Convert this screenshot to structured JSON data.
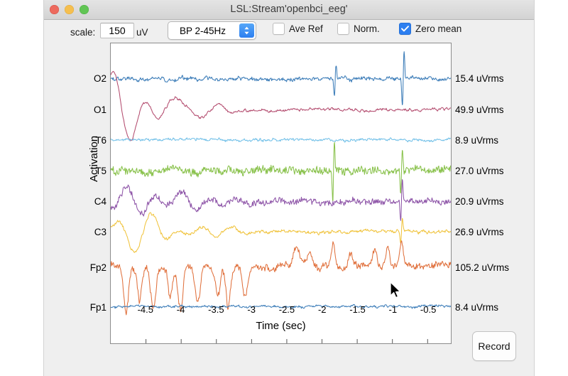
{
  "window": {
    "title": "LSL:Stream'openbci_eeg'",
    "traffic_lights": [
      "close-red",
      "minimize-yellow",
      "zoom-green"
    ]
  },
  "toolbar": {
    "scale_label": "scale:",
    "scale_value": "150",
    "scale_placeholder": "150",
    "unit_label": "uV",
    "filter_selected": "BP 2-45Hz",
    "filter_options": [
      "BP 2-45Hz"
    ],
    "checkboxes": [
      {
        "name": "ave-ref",
        "label": "Ave Ref",
        "checked": false
      },
      {
        "name": "norm",
        "label": "Norm.",
        "checked": false
      },
      {
        "name": "zero-mean",
        "label": "Zero mean",
        "checked": true
      }
    ]
  },
  "plot": {
    "ylabel": "Activation",
    "xlabel": "Time (sec)",
    "xticks": [
      "-4.5",
      "-4",
      "-3.5",
      "-3",
      "-2.5",
      "-2",
      "-1.5",
      "-1",
      "-0.5"
    ],
    "channel_labels": [
      "O2",
      "O1",
      "T6",
      "T5",
      "C4",
      "C3",
      "Fp2",
      "Fp1"
    ],
    "rms_labels": [
      "15.4 uVrms",
      "49.9 uVrms",
      "8.9 uVrms",
      "27.0 uVrms",
      "20.9 uVrms",
      "26.9 uVrms",
      "105.2 uVrms",
      "8.4 uVrms"
    ]
  },
  "buttons": {
    "record": "Record"
  },
  "colors": {
    "accent": "#2d7ff0",
    "window_bg": "#efefef",
    "plot_bg": "#ffffff",
    "traces": {
      "O2": "#3b7cb8",
      "O1": "#b34b6e",
      "T6": "#72c0e8",
      "T5": "#88c14a",
      "C4": "#8e55a8",
      "C3": "#f0c33c",
      "Fp2": "#e0703c",
      "Fp1": "#3b7cb8"
    }
  },
  "chart_data": {
    "type": "line",
    "title": "LSL:Stream'openbci_eeg'",
    "xlabel": "Time (sec)",
    "ylabel": "Activation",
    "xlim": [
      -5.0,
      -0.17
    ],
    "xticks": [
      -4.5,
      -4,
      -3.5,
      -3,
      -2.5,
      -2,
      -1.5,
      -1,
      -0.5
    ],
    "grid": false,
    "legend": "right-rms-annotations",
    "scale_uV": 150,
    "filter": "BP 2-45Hz",
    "series": [
      {
        "name": "O2",
        "color": "#3b7cb8",
        "rms_uV": 15.4,
        "baseline_y_frac": 0.118,
        "amplitude": 0.03,
        "noise": 0.9,
        "spikes": [
          [
            0.66,
            1.7
          ],
          [
            0.86,
            3.2
          ]
        ]
      },
      {
        "name": "O1",
        "color": "#b34b6e",
        "rms_uV": 49.9,
        "baseline_y_frac": 0.222,
        "amplitude": 0.03,
        "noise": 0.5,
        "slow_wave": true,
        "spikes": []
      },
      {
        "name": "T6",
        "color": "#72c0e8",
        "rms_uV": 8.9,
        "baseline_y_frac": 0.322,
        "amplitude": 0.022,
        "noise": 0.8,
        "spikes": []
      },
      {
        "name": "T5",
        "color": "#88c14a",
        "rms_uV": 27.0,
        "baseline_y_frac": 0.425,
        "amplitude": 0.04,
        "noise": 1.6,
        "spikes": [
          [
            0.655,
            2.6
          ],
          [
            0.855,
            2.0
          ]
        ]
      },
      {
        "name": "C4",
        "color": "#8e55a8",
        "rms_uV": 20.9,
        "baseline_y_frac": 0.527,
        "amplitude": 0.034,
        "noise": 1.4,
        "slow_wave": true,
        "spikes": [
          [
            0.855,
            2.2
          ]
        ]
      },
      {
        "name": "C3",
        "color": "#f0c33c",
        "rms_uV": 26.9,
        "baseline_y_frac": 0.628,
        "amplitude": 0.03,
        "noise": 0.7,
        "slow_wave": true,
        "spikes": [
          [
            0.855,
            1.4
          ]
        ]
      },
      {
        "name": "Fp2",
        "color": "#e0703c",
        "rms_uV": 105.2,
        "baseline_y_frac": 0.745,
        "amplitude": 0.05,
        "noise": 1.0,
        "blinks": true,
        "spikes": []
      },
      {
        "name": "Fp1",
        "color": "#3b7cb8",
        "rms_uV": 8.4,
        "baseline_y_frac": 0.877,
        "amplitude": 0.018,
        "noise": 0.9,
        "spikes": []
      }
    ]
  }
}
